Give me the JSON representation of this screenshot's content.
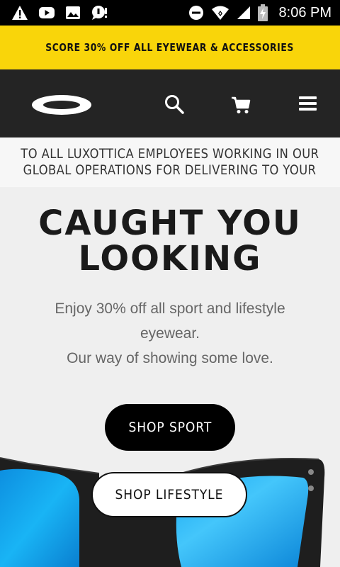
{
  "status_bar": {
    "time": "8:06 PM",
    "left_icons": [
      "warning-icon",
      "youtube-icon",
      "image-icon",
      "chat-icon"
    ],
    "right_icons": [
      "do-not-disturb-icon",
      "wifi-icon",
      "signal-icon",
      "battery-charging-icon"
    ]
  },
  "promo_banner": {
    "text": "SCORE 30% OFF ALL EYEWEAR & ACCESSORIES"
  },
  "header": {
    "logo": "oakley-ellipse-logo",
    "icons": [
      "search-icon",
      "cart-icon",
      "menu-icon"
    ]
  },
  "ticker": {
    "line1": "TO ALL LUXOTTICA EMPLOYEES WORKING IN OUR",
    "line2": "GLOBAL OPERATIONS FOR DELIVERING TO YOUR"
  },
  "hero": {
    "headline_line1": "CAUGHT YOU",
    "headline_line2": "LOOKING",
    "sub_line1": "Enjoy 30% off all sport and lifestyle",
    "sub_line2": "eyewear.",
    "sub_line3": "Our way of showing some love.",
    "button_sport": "SHOP SPORT",
    "button_lifestyle": "SHOP LIFESTYLE"
  },
  "colors": {
    "promo_bg": "#f9d50a",
    "nav_bg": "#242424",
    "hero_bg": "#efefef",
    "lens_blue": "#12a8f0"
  }
}
